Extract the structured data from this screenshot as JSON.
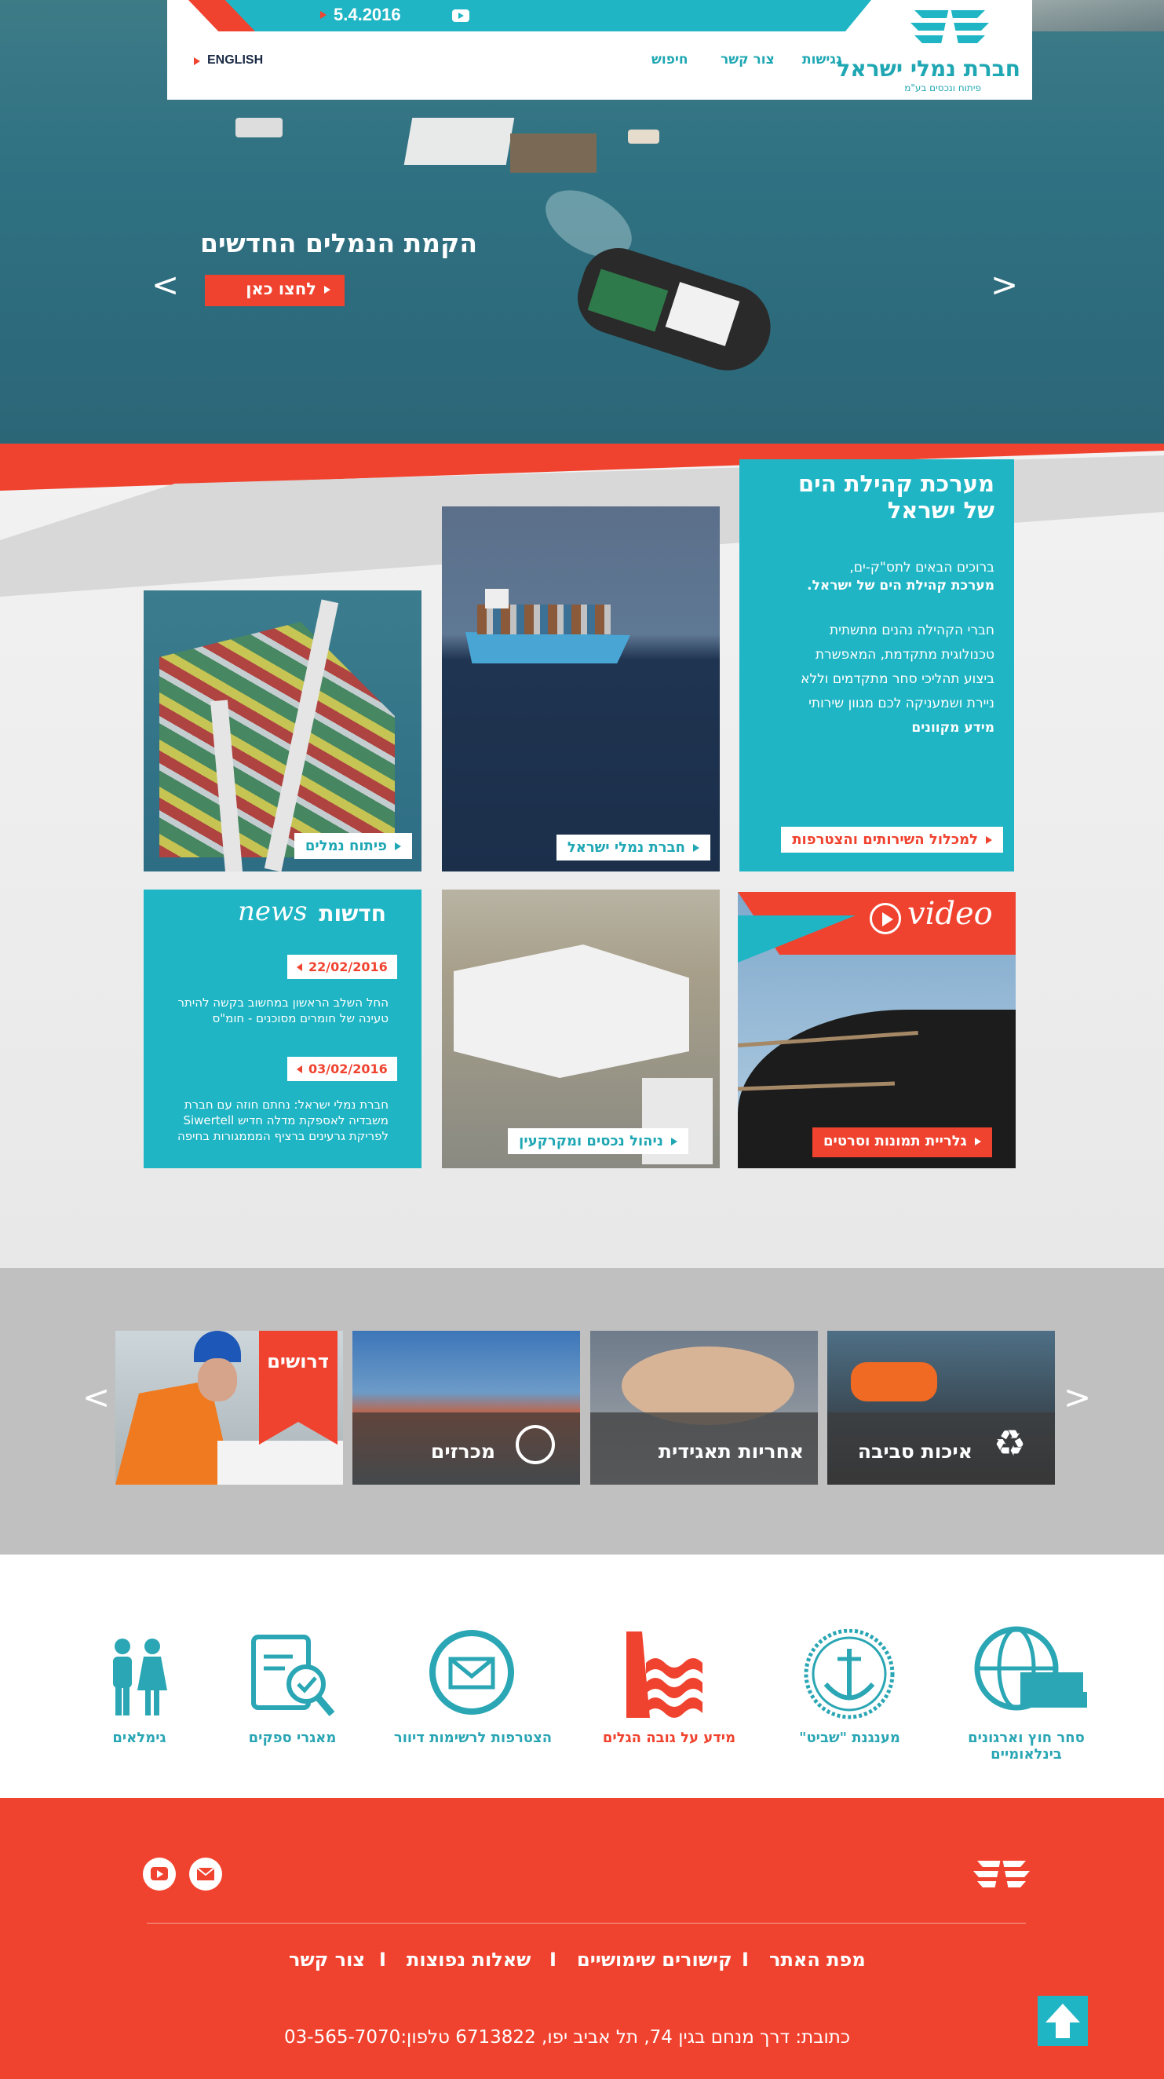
{
  "header": {
    "date": "5.4.2016",
    "english": "ENGLISH",
    "nav": [
      "נגישות",
      "צור קשר",
      "חיפוש"
    ],
    "logo_title": "חברת נמלי ישראל",
    "logo_subtitle": "פיתוח ונכסים בע\"מ"
  },
  "hero": {
    "title": "הקמת הנמלים החדשים",
    "cta": "לחצו כאן",
    "prev": "<",
    "next": ">"
  },
  "intro": {
    "title_line1": "מערכת קהילת הים",
    "title_line2": "של ישראל",
    "p1": "ברוכים הבאים לתס\"ק-ים,",
    "p1b": "מערכת קהילת הים של ישראל.",
    "p2_l1": "חברי הקהילה נהנים מתשתית",
    "p2_l2": "טכנולוגית מתקדמת, המאפשרת",
    "p2_l3": "ביצוע תהליכי סחר מתקדמים וללא",
    "p2_l4": "ניירת ושמעניקה לכם מגוון שירותי",
    "p2_l5": "מידע מקוונים",
    "cta": "למכלול השירותים והצטרפות"
  },
  "cards": {
    "ports_dev": "פיתוח נמלים",
    "israel_ports": "חברת נמלי ישראל",
    "assets": "ניהול נכסים ומקרקעין",
    "gallery": "גלריית תמונות וסרטים",
    "video_word": "video"
  },
  "news": {
    "title_he": "חדשות",
    "title_en": "news",
    "items": [
      {
        "date": "22/02/2016",
        "l1": "החל השלב הראשון במחשוב בקשה להיתר",
        "l2": "טעינה של חומרים מסוכנים - חומ\"ס"
      },
      {
        "date": "03/02/2016",
        "l1": "חברת נמלי ישראל: נחתם חוזה עם חברת",
        "l2": "משבדיה לאספקת מדלה חדיש Siwertell",
        "l3": "לפריקת גרעינים ברציף המממגורות בחיפה"
      }
    ]
  },
  "strip": {
    "items": [
      "איכות סביבה",
      "אחריות תאגידית",
      "מכרזים",
      "דרושים"
    ],
    "prev": "<",
    "next": ">"
  },
  "icons": [
    {
      "name": "סחר חוץ וארגונים",
      "name2": "בינלאומיים",
      "color": "#2aa6b4"
    },
    {
      "name": "מענגנת \"שביט\"",
      "name2": "",
      "color": "#2aa6b4"
    },
    {
      "name": "מידע על גובה הגלים",
      "name2": "",
      "color": "#f0432f"
    },
    {
      "name": "הצטרפות לרשימות דיוור",
      "name2": "",
      "color": "#2aa6b4"
    },
    {
      "name": "מאגרי ספקים",
      "name2": "",
      "color": "#2aa6b4"
    },
    {
      "name": "גימלאים",
      "name2": "",
      "color": "#2aa6b4"
    }
  ],
  "footer": {
    "links": [
      "מפת האתר",
      "קישורים שימושיים",
      "שאלות נפוצות",
      "צור קשר"
    ],
    "sep": "I",
    "address": "כתובת: דרך מנחם בגין 74, תל אביב יפו,  6713822  טלפון:03-565-7070"
  },
  "colors": {
    "teal": "#1fb5c4",
    "red": "#f0432f",
    "grey": "#bdbdbd"
  }
}
